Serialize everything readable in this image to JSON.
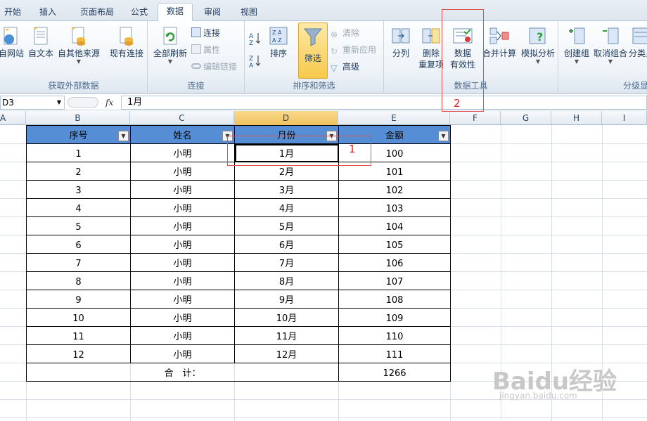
{
  "ribbon_tabs": [
    "开始",
    "插入",
    "页面布局",
    "公式",
    "数据",
    "审阅",
    "视图"
  ],
  "active_tab": "数据",
  "groups": {
    "external": {
      "label": "获取外部数据",
      "from_web": "自网站",
      "from_text": "自文本",
      "from_other": "自其他来源",
      "existing": "现有连接"
    },
    "connections": {
      "label": "连接",
      "refresh_all": "全部刷新",
      "connections": "连接",
      "properties": "属性",
      "edit_links": "编辑链接"
    },
    "sort_filter": {
      "label": "排序和筛选",
      "sort": "排序",
      "filter": "筛选",
      "clear": "清除",
      "reapply": "重新应用",
      "advanced": "高级"
    },
    "data_tools": {
      "label": "数据工具",
      "text_to_columns": "分列",
      "remove_dup_l1": "删除",
      "remove_dup_l2": "重复项",
      "validation_l1": "数据",
      "validation_l2": "有效性",
      "consolidate": "合并计算",
      "what_if": "模拟分析"
    },
    "outline": {
      "label": "分级显",
      "group": "创建组",
      "ungroup": "取消组合",
      "subtotal": "分类显"
    }
  },
  "name_box": "D3",
  "fx_label": "fx",
  "formula_value": "1月",
  "columns": [
    "A",
    "B",
    "C",
    "D",
    "E",
    "F",
    "G",
    "H",
    "I"
  ],
  "table": {
    "headers": [
      "序号",
      "姓名",
      "月份",
      "金额"
    ],
    "rows": [
      [
        "1",
        "小明",
        "1月",
        "100"
      ],
      [
        "2",
        "小明",
        "2月",
        "101"
      ],
      [
        "3",
        "小明",
        "3月",
        "102"
      ],
      [
        "4",
        "小明",
        "4月",
        "103"
      ],
      [
        "5",
        "小明",
        "5月",
        "104"
      ],
      [
        "6",
        "小明",
        "6月",
        "105"
      ],
      [
        "7",
        "小明",
        "7月",
        "106"
      ],
      [
        "8",
        "小明",
        "8月",
        "107"
      ],
      [
        "9",
        "小明",
        "9月",
        "108"
      ],
      [
        "10",
        "小明",
        "10月",
        "109"
      ],
      [
        "11",
        "小明",
        "11月",
        "110"
      ],
      [
        "12",
        "小明",
        "12月",
        "111"
      ]
    ],
    "total_label": "合　计：",
    "total_value": "1266"
  },
  "annotations": {
    "label1": "1",
    "label2": "2"
  },
  "watermark": {
    "main": "Baidu经验",
    "sub": "jingyan.baidu.com"
  },
  "colors": {
    "header_fill": "#558ed5",
    "annotation": "#e02020",
    "selected_col": "#f1c15f"
  }
}
